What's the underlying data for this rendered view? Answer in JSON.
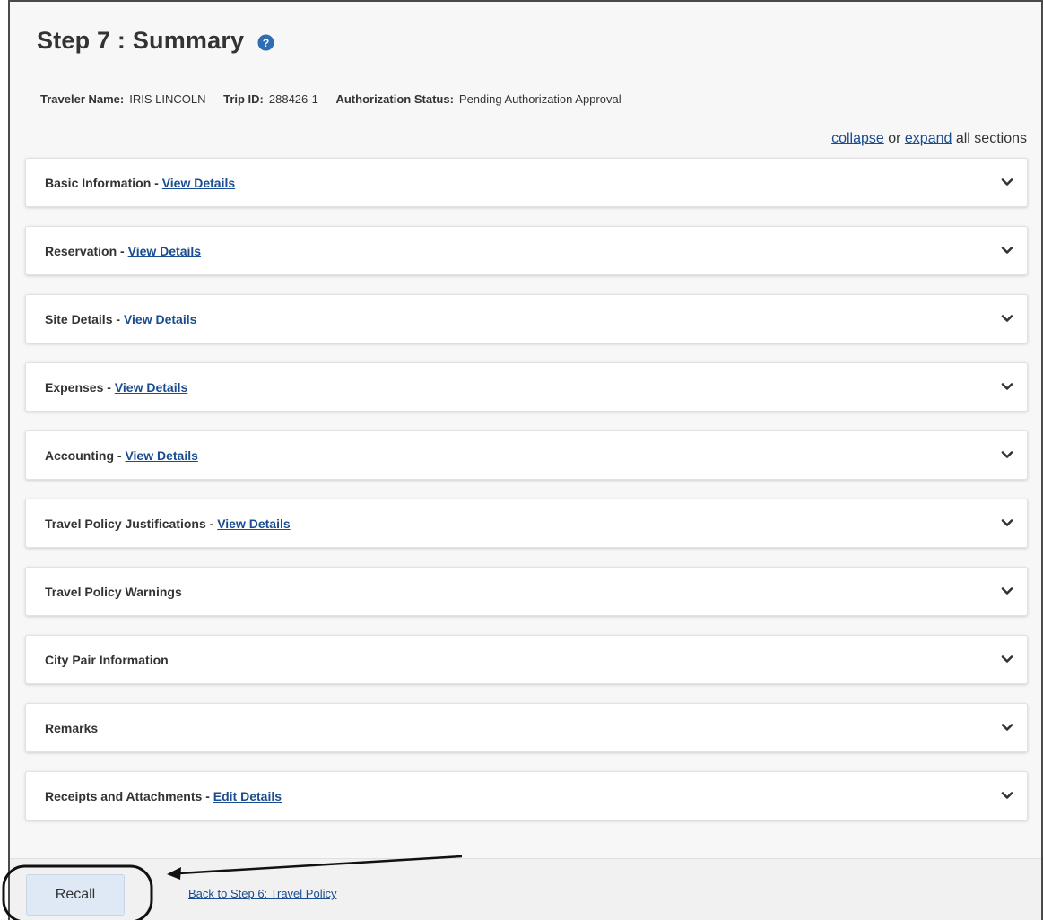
{
  "page": {
    "title": "Step 7 : Summary",
    "help_icon": "question-circle-icon"
  },
  "meta": {
    "traveler_label": "Traveler Name:",
    "traveler_value": "IRIS LINCOLN",
    "trip_label": "Trip ID:",
    "trip_value": "288426-1",
    "status_label": "Authorization Status:",
    "status_value": "Pending Authorization Approval"
  },
  "toggle": {
    "collapse": "collapse",
    "or": " or ",
    "expand": "expand",
    "suffix": " all sections"
  },
  "sections": [
    {
      "title": "Basic Information",
      "link": "View Details"
    },
    {
      "title": "Reservation",
      "link": "View Details"
    },
    {
      "title": "Site Details",
      "link": "View Details"
    },
    {
      "title": "Expenses",
      "link": "View Details"
    },
    {
      "title": "Accounting",
      "link": "View Details"
    },
    {
      "title": "Travel Policy Justifications",
      "link": "View Details"
    },
    {
      "title": "Travel Policy Warnings",
      "link": ""
    },
    {
      "title": "City Pair Information",
      "link": ""
    },
    {
      "title": "Remarks",
      "link": ""
    },
    {
      "title": "Receipts and Attachments",
      "link": "Edit Details"
    }
  ],
  "footer": {
    "recall_label": "Recall",
    "back_link": "Back to Step 6: Travel Policy"
  },
  "colors": {
    "link": "#1a4d8f",
    "button_bg": "#dfe9f5",
    "help_icon": "#2f6db5"
  }
}
